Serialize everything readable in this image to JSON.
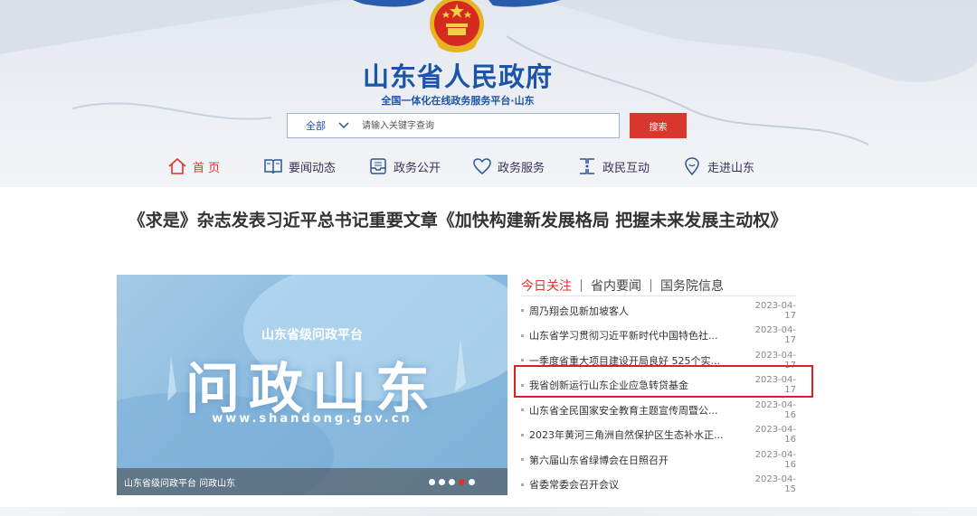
{
  "header": {
    "site_title": "山东省人民政府",
    "site_subtitle": "全国一体化在线政务服务平台·山东",
    "search": {
      "scope_label": "全部",
      "placeholder": "请输入关键字查询",
      "button_label": "搜索"
    }
  },
  "nav": {
    "items": [
      {
        "label": "首 页",
        "icon": "home-icon",
        "active": true
      },
      {
        "label": "要闻动态",
        "icon": "book-icon",
        "active": false
      },
      {
        "label": "政务公开",
        "icon": "inbox-icon",
        "active": false
      },
      {
        "label": "政务服务",
        "icon": "heart-icon",
        "active": false
      },
      {
        "label": "政民互动",
        "icon": "interaction-icon",
        "active": false
      },
      {
        "label": "走进山东",
        "icon": "location-icon",
        "active": false
      }
    ]
  },
  "headline": "《求是》杂志发表习近平总书记重要文章《加快构建新发展格局 把握未来发展主动权》",
  "carousel": {
    "slide_platform": "山东省级问政平台",
    "slide_title": "问政山东",
    "slide_url": "www.shandong.gov.cn",
    "caption": "山东省级问政平台 问政山东",
    "dot_count": 5,
    "active_dot": 3
  },
  "news": {
    "tabs": [
      {
        "label": "今日关注",
        "active": true
      },
      {
        "label": "省内要闻",
        "active": false
      },
      {
        "label": "国务院信息",
        "active": false
      }
    ],
    "items": [
      {
        "title": "周乃翔会见新加坡客人",
        "date": "2023-04-17"
      },
      {
        "title": "山东省学习贯彻习近平新时代中国特色社...",
        "date": "2023-04-17"
      },
      {
        "title": "一季度省重大项目建设开局良好 525个实...",
        "date": "2023-04-17"
      },
      {
        "title": "我省创新运行山东企业应急转贷基金",
        "date": "2023-04-17"
      },
      {
        "title": "山东省全民国家安全教育主题宣传周暨公...",
        "date": "2023-04-16"
      },
      {
        "title": "2023年黄河三角洲自然保护区生态补水正...",
        "date": "2023-04-16"
      },
      {
        "title": "第六届山东省绿博会在日照召开",
        "date": "2023-04-16"
      },
      {
        "title": "省委常委会召开会议",
        "date": "2023-04-15"
      }
    ],
    "highlighted_index": 3
  },
  "colors": {
    "brand_blue": "#1d55a6",
    "accent_red": "#d9362d",
    "highlight_border": "#e02020"
  }
}
